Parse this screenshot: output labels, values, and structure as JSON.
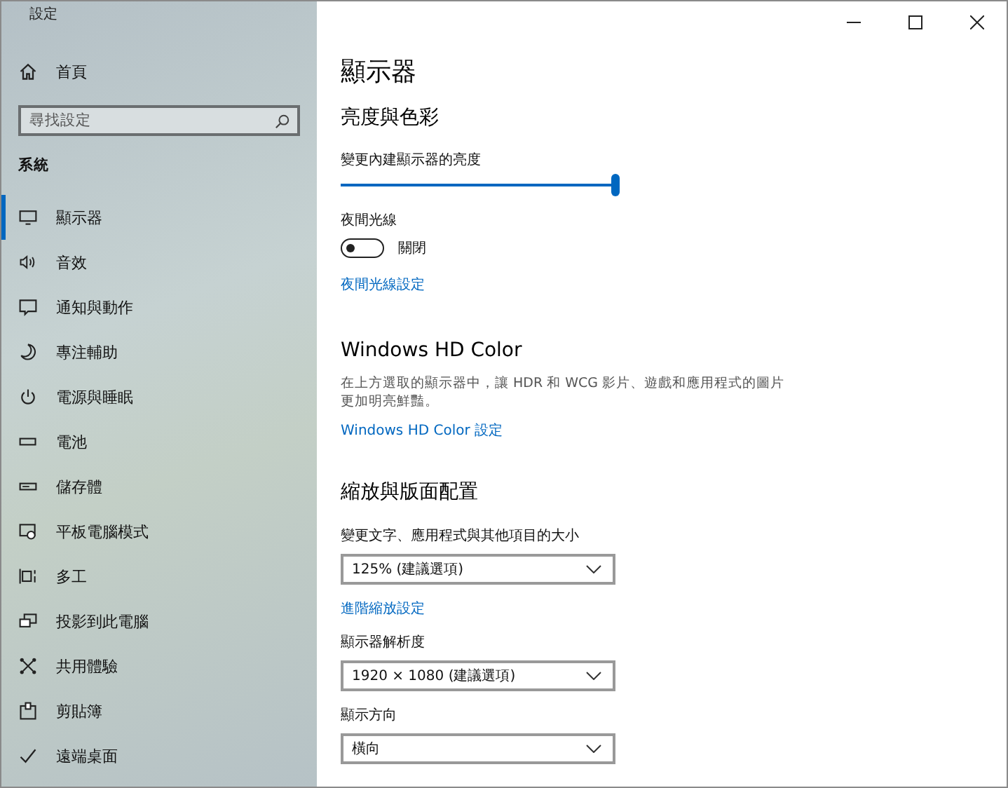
{
  "window": {
    "title": "設定"
  },
  "sidebar": {
    "home": "首頁",
    "search": {
      "placeholder": "尋找設定"
    },
    "section": "系統",
    "items": [
      {
        "label": "顯示器",
        "selected": true
      },
      {
        "label": "音效",
        "selected": false
      },
      {
        "label": "通知與動作",
        "selected": false
      },
      {
        "label": "專注輔助",
        "selected": false
      },
      {
        "label": "電源與睡眠",
        "selected": false
      },
      {
        "label": "電池",
        "selected": false
      },
      {
        "label": "儲存體",
        "selected": false
      },
      {
        "label": "平板電腦模式",
        "selected": false
      },
      {
        "label": "多工",
        "selected": false
      },
      {
        "label": "投影到此電腦",
        "selected": false
      },
      {
        "label": "共用體驗",
        "selected": false
      },
      {
        "label": "剪貼簿",
        "selected": false
      },
      {
        "label": "遠端桌面",
        "selected": false
      }
    ]
  },
  "page": {
    "title": "顯示器",
    "brightness_section": {
      "heading": "亮度與色彩",
      "slider_label": "變更內建顯示器的亮度",
      "level": 1.0,
      "night_light_label": "夜間光線",
      "night_light": {
        "on": false,
        "state_text": "關閉"
      },
      "link": "夜間光線設定"
    },
    "hd_color": {
      "heading": "Windows HD Color",
      "description": "在上方選取的顯示器中，讓 HDR 和 WCG 影片、遊戲和應用程式的圖片更加明亮鮮豔。",
      "link": "Windows HD Color 設定"
    },
    "scale_layout": {
      "heading": "縮放與版面配置",
      "fields": [
        {
          "label": "變更文字、應用程式與其他項目的大小",
          "value": "125% (建議選項)"
        },
        {
          "kind": "link",
          "label": "進階縮放設定"
        },
        {
          "label": "顯示器解析度",
          "value": "1920 × 1080 (建議選項)"
        },
        {
          "label": "顯示方向",
          "value": "橫向"
        }
      ]
    }
  }
}
